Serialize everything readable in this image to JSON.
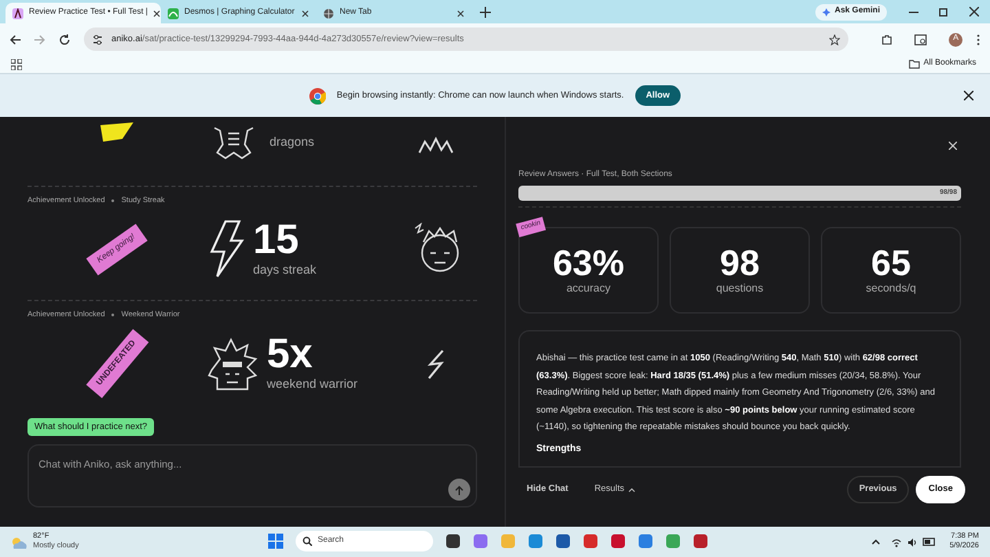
{
  "browser": {
    "tabs": [
      {
        "title": "Review Practice Test • Full Test |",
        "selected": true,
        "kind": "aniko"
      },
      {
        "title": "Desmos | Graphing Calculator",
        "selected": false,
        "kind": "desmos"
      },
      {
        "title": "New Tab",
        "selected": false,
        "kind": "globe"
      }
    ],
    "gemini": "Ask Gemini",
    "url_host": "aniko.ai",
    "url_path": "/sat/practice-test/13299294-7993-44aa-944d-4a273d30557e/review?view=results",
    "profile": "A",
    "bookmarks": "All Bookmarks",
    "infobar": {
      "message": "Begin browsing instantly: Chrome can now launch when Windows starts.",
      "button": "Allow"
    }
  },
  "achievements": [
    {
      "kind": "dragons",
      "caption": "dragons",
      "color": "#f0e51d"
    },
    {
      "kind": "streak",
      "header": "Achievement Unlocked",
      "subject": "Study Streak",
      "sticker": "Keep going!",
      "color": "#e07ad3",
      "value": "15",
      "caption": "days streak"
    },
    {
      "kind": "warrior",
      "header": "Achievement Unlocked",
      "subject": "Weekend Warrior",
      "sticker": "UNDEFEATED",
      "color": "#e07ad3",
      "value": "5x",
      "caption": "weekend warrior"
    }
  ],
  "chat": {
    "suggestion": "What should I practice next?",
    "placeholder": "Chat with Aniko, ask anything..."
  },
  "review": {
    "title": "Review Answers · Full Test, Both Sections",
    "progress": {
      "level": 1,
      "reading": "98/98"
    },
    "badge": "cookin",
    "stats": [
      {
        "value": "63%",
        "label": "accuracy"
      },
      {
        "value": "98",
        "label": "questions"
      },
      {
        "value": "65",
        "label": "seconds/q"
      }
    ],
    "summary": "Abishai — this practice test came in at **1050** (Reading/Writing **540**, Math **510**) with **62/98 correct (63.3%)**. Biggest score leak: **Hard 18/35 (51.4%)** plus a few medium misses (20/34, 58.8%). Your Reading/Writing held up better; Math dipped mainly from Geometry And Trigonometry (2/6, 33%) and some Algebra execution. This test score is also **~90 points below** your running estimated score (~1140), so tightening the repeatable mistakes should bounce you back quickly.",
    "heading": "Strengths",
    "footer": {
      "hide": "Hide Chat",
      "results": "Results",
      "previous": "Previous",
      "close": "Close"
    }
  },
  "taskbar": {
    "temperature": "82°F",
    "weather": "Mostly cloudy",
    "search": "Search",
    "time": "7:38 PM",
    "date": "5/9/2026"
  }
}
